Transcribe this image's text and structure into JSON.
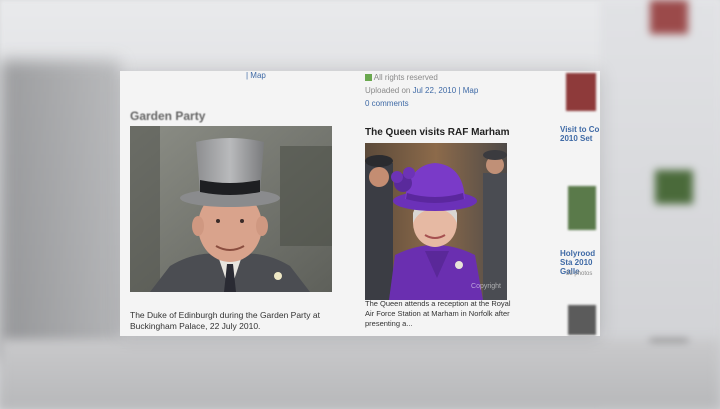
{
  "page": {
    "left_column": {
      "top_meta": "| Map",
      "section_title": "Garden Party",
      "photo_caption": "The Duke of Edinburgh during the Garden Party at Buckingham Palace, 22 July 2010."
    },
    "right_column": {
      "rights": "All rights reserved",
      "uploaded_prefix": "Uploaded on",
      "uploaded_date": "Jul 22, 2010",
      "map_link": "| Map",
      "comments": "0 comments",
      "photo_title": "The Queen visits RAF Marham",
      "photo_caption": "The Queen attends a reception at the Royal Air Force Station at Marham in Norfolk after presenting a...",
      "watermark": "Copyright"
    },
    "sidebar": {
      "item1_title": "Visit to Co 2010 Set",
      "item2_title": "Holyrood Sta 2010 Galle",
      "item2_count": "33 photos"
    }
  }
}
